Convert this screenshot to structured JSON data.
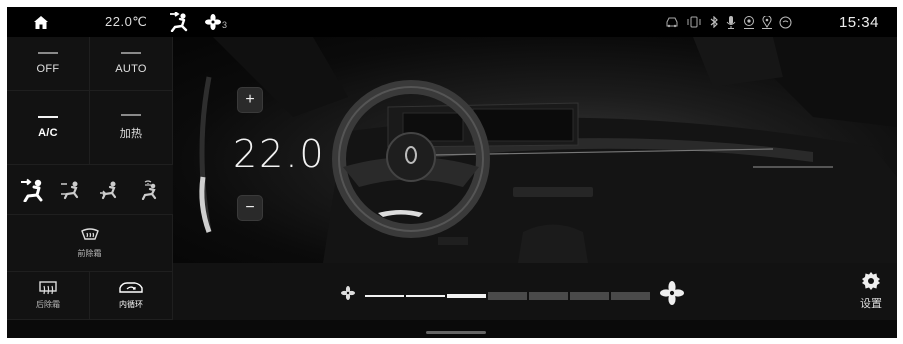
{
  "status_bar": {
    "home_icon": "home-icon",
    "temperature": "22.0℃",
    "airflow_icon": "airflow-face-icon",
    "fan_icon": "fan-icon",
    "fan_level": "3",
    "system_icons": [
      "car-icon",
      "vibrate-icon",
      "bluetooth-icon",
      "microphone-icon",
      "signal-icon",
      "location-icon",
      "wifi-off-icon"
    ],
    "time": "15:34"
  },
  "left_panel": {
    "off_label": "OFF",
    "auto_label": "AUTO",
    "ac_label": "A/C",
    "heat_label": "加热",
    "modes": [
      {
        "icon": "airflow-face-icon",
        "active": true
      },
      {
        "icon": "airflow-face-feet-icon",
        "active": false
      },
      {
        "icon": "airflow-feet-icon",
        "active": false
      },
      {
        "icon": "airflow-feet-defrost-icon",
        "active": false
      }
    ],
    "front_defrost_label": "前除霜",
    "rear_defrost_label": "后除霜",
    "recirculation_label": "内循环"
  },
  "climate": {
    "set_temperature": "22.0",
    "increase_label": "+",
    "decrease_label": "−"
  },
  "fan": {
    "level": 3,
    "max_level": 7
  },
  "settings": {
    "label": "设置",
    "icon": "gear-icon"
  },
  "colors": {
    "background": "#050505",
    "panel": "#121212",
    "active": "#f2f2f2",
    "inactive": "#4a4a4a"
  }
}
